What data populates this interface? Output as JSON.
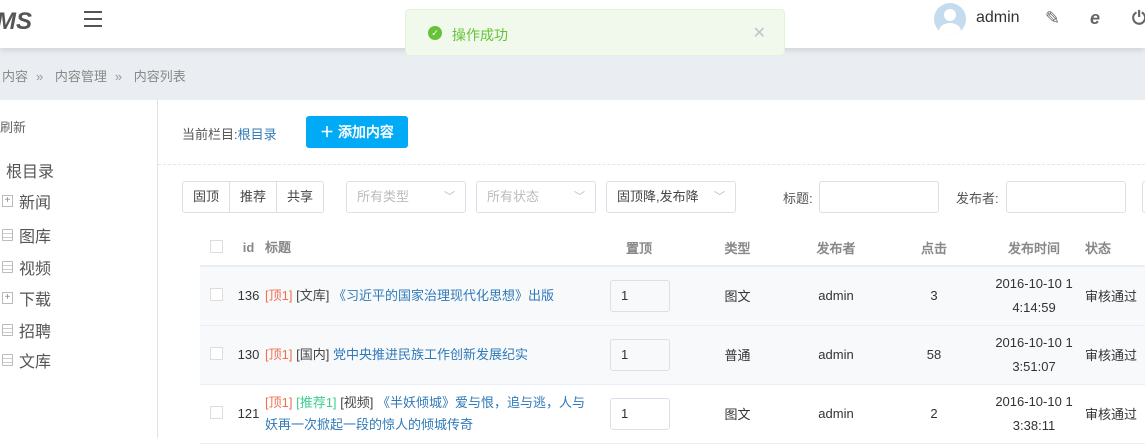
{
  "header": {
    "logo": "MS",
    "user": "admin"
  },
  "toast": {
    "message": "操作成功"
  },
  "breadcrumb": [
    "内容",
    "内容管理",
    "内容列表"
  ],
  "sidebar": {
    "refresh": "刷新",
    "root": "根目录",
    "items": [
      {
        "label": "新闻",
        "type": "folder"
      },
      {
        "label": "图库",
        "type": "doc"
      },
      {
        "label": "视频",
        "type": "doc"
      },
      {
        "label": "下载",
        "type": "folder"
      },
      {
        "label": "招聘",
        "type": "doc"
      },
      {
        "label": "文库",
        "type": "doc"
      }
    ]
  },
  "main": {
    "current_label": "当前栏目:",
    "current_value": "根目录",
    "add_button": "添加内容",
    "filters": {
      "flags": [
        "固顶",
        "推荐",
        "共享"
      ],
      "type_placeholder": "所有类型",
      "status_placeholder": "所有状态",
      "sort": "固顶降,发布降",
      "title_label": "标题:",
      "title_value": "",
      "publisher_label": "发布者:",
      "publisher_value": ""
    },
    "columns": [
      "id",
      "标题",
      "置顶",
      "类型",
      "发布者",
      "点击",
      "发布时间",
      "状态"
    ],
    "rows": [
      {
        "id": "136",
        "top": "[顶1]",
        "rec": "",
        "cat": "[文库]",
        "title": "《习近平的国家治理现代化思想》出版",
        "pin": "1",
        "type": "图文",
        "publisher": "admin",
        "clicks": "3",
        "time": "2016-10-10 14:14:59",
        "status": "审核通过"
      },
      {
        "id": "130",
        "top": "[顶1]",
        "rec": "",
        "cat": "[国内]",
        "title": "党中央推进民族工作创新发展纪实",
        "pin": "1",
        "type": "普通",
        "publisher": "admin",
        "clicks": "58",
        "time": "2016-10-10 13:51:07",
        "status": "审核通过"
      },
      {
        "id": "121",
        "top": "[顶1]",
        "rec": "[推荐1]",
        "cat": "[视频]",
        "title": "《半妖倾城》爱与恨，追与逃，人与妖再一次掀起一段的惊人的倾城传奇",
        "pin": "1",
        "type": "图文",
        "publisher": "admin",
        "clicks": "2",
        "time": "2016-10-10 13:38:11",
        "status": "审核通过"
      }
    ]
  }
}
